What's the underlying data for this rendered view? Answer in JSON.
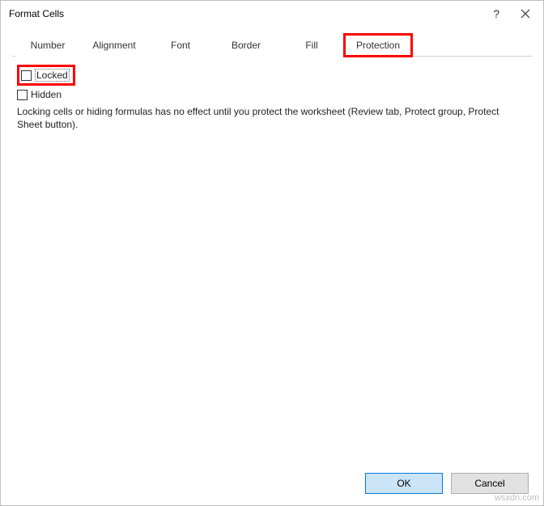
{
  "title": "Format Cells",
  "tabs": {
    "number": "Number",
    "alignment": "Alignment",
    "font": "Font",
    "border": "Border",
    "fill": "Fill",
    "protection": "Protection"
  },
  "protection": {
    "locked_label": "Locked",
    "hidden_label": "Hidden",
    "description": "Locking cells or hiding formulas has no effect until you protect the worksheet (Review tab, Protect group, Protect Sheet button)."
  },
  "buttons": {
    "ok": "OK",
    "cancel": "Cancel"
  },
  "watermark": "wsxdn.com"
}
